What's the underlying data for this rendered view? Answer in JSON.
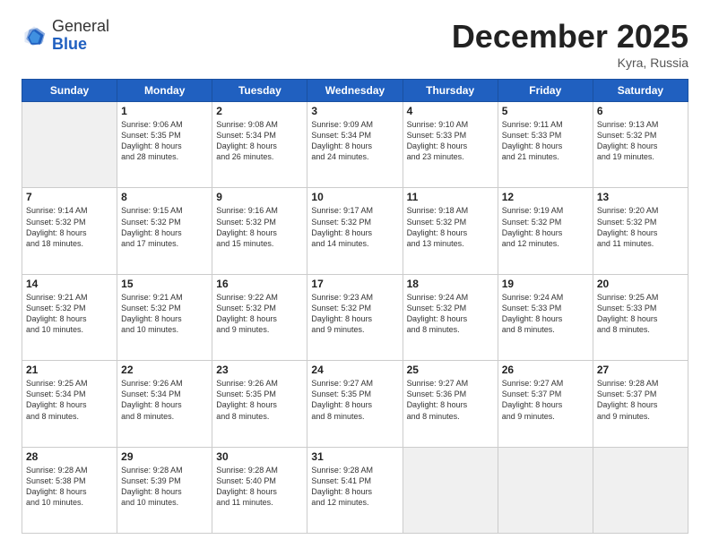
{
  "logo": {
    "general": "General",
    "blue": "Blue"
  },
  "header": {
    "month": "December 2025",
    "location": "Kyra, Russia"
  },
  "days_of_week": [
    "Sunday",
    "Monday",
    "Tuesday",
    "Wednesday",
    "Thursday",
    "Friday",
    "Saturday"
  ],
  "weeks": [
    [
      {
        "day": "",
        "info": "",
        "empty": true
      },
      {
        "day": "1",
        "info": "Sunrise: 9:06 AM\nSunset: 5:35 PM\nDaylight: 8 hours\nand 28 minutes."
      },
      {
        "day": "2",
        "info": "Sunrise: 9:08 AM\nSunset: 5:34 PM\nDaylight: 8 hours\nand 26 minutes."
      },
      {
        "day": "3",
        "info": "Sunrise: 9:09 AM\nSunset: 5:34 PM\nDaylight: 8 hours\nand 24 minutes."
      },
      {
        "day": "4",
        "info": "Sunrise: 9:10 AM\nSunset: 5:33 PM\nDaylight: 8 hours\nand 23 minutes."
      },
      {
        "day": "5",
        "info": "Sunrise: 9:11 AM\nSunset: 5:33 PM\nDaylight: 8 hours\nand 21 minutes."
      },
      {
        "day": "6",
        "info": "Sunrise: 9:13 AM\nSunset: 5:32 PM\nDaylight: 8 hours\nand 19 minutes."
      }
    ],
    [
      {
        "day": "7",
        "info": "Sunrise: 9:14 AM\nSunset: 5:32 PM\nDaylight: 8 hours\nand 18 minutes."
      },
      {
        "day": "8",
        "info": "Sunrise: 9:15 AM\nSunset: 5:32 PM\nDaylight: 8 hours\nand 17 minutes."
      },
      {
        "day": "9",
        "info": "Sunrise: 9:16 AM\nSunset: 5:32 PM\nDaylight: 8 hours\nand 15 minutes."
      },
      {
        "day": "10",
        "info": "Sunrise: 9:17 AM\nSunset: 5:32 PM\nDaylight: 8 hours\nand 14 minutes."
      },
      {
        "day": "11",
        "info": "Sunrise: 9:18 AM\nSunset: 5:32 PM\nDaylight: 8 hours\nand 13 minutes."
      },
      {
        "day": "12",
        "info": "Sunrise: 9:19 AM\nSunset: 5:32 PM\nDaylight: 8 hours\nand 12 minutes."
      },
      {
        "day": "13",
        "info": "Sunrise: 9:20 AM\nSunset: 5:32 PM\nDaylight: 8 hours\nand 11 minutes."
      }
    ],
    [
      {
        "day": "14",
        "info": "Sunrise: 9:21 AM\nSunset: 5:32 PM\nDaylight: 8 hours\nand 10 minutes."
      },
      {
        "day": "15",
        "info": "Sunrise: 9:21 AM\nSunset: 5:32 PM\nDaylight: 8 hours\nand 10 minutes."
      },
      {
        "day": "16",
        "info": "Sunrise: 9:22 AM\nSunset: 5:32 PM\nDaylight: 8 hours\nand 9 minutes."
      },
      {
        "day": "17",
        "info": "Sunrise: 9:23 AM\nSunset: 5:32 PM\nDaylight: 8 hours\nand 9 minutes."
      },
      {
        "day": "18",
        "info": "Sunrise: 9:24 AM\nSunset: 5:32 PM\nDaylight: 8 hours\nand 8 minutes."
      },
      {
        "day": "19",
        "info": "Sunrise: 9:24 AM\nSunset: 5:33 PM\nDaylight: 8 hours\nand 8 minutes."
      },
      {
        "day": "20",
        "info": "Sunrise: 9:25 AM\nSunset: 5:33 PM\nDaylight: 8 hours\nand 8 minutes."
      }
    ],
    [
      {
        "day": "21",
        "info": "Sunrise: 9:25 AM\nSunset: 5:34 PM\nDaylight: 8 hours\nand 8 minutes."
      },
      {
        "day": "22",
        "info": "Sunrise: 9:26 AM\nSunset: 5:34 PM\nDaylight: 8 hours\nand 8 minutes."
      },
      {
        "day": "23",
        "info": "Sunrise: 9:26 AM\nSunset: 5:35 PM\nDaylight: 8 hours\nand 8 minutes."
      },
      {
        "day": "24",
        "info": "Sunrise: 9:27 AM\nSunset: 5:35 PM\nDaylight: 8 hours\nand 8 minutes."
      },
      {
        "day": "25",
        "info": "Sunrise: 9:27 AM\nSunset: 5:36 PM\nDaylight: 8 hours\nand 8 minutes."
      },
      {
        "day": "26",
        "info": "Sunrise: 9:27 AM\nSunset: 5:37 PM\nDaylight: 8 hours\nand 9 minutes."
      },
      {
        "day": "27",
        "info": "Sunrise: 9:28 AM\nSunset: 5:37 PM\nDaylight: 8 hours\nand 9 minutes."
      }
    ],
    [
      {
        "day": "28",
        "info": "Sunrise: 9:28 AM\nSunset: 5:38 PM\nDaylight: 8 hours\nand 10 minutes."
      },
      {
        "day": "29",
        "info": "Sunrise: 9:28 AM\nSunset: 5:39 PM\nDaylight: 8 hours\nand 10 minutes."
      },
      {
        "day": "30",
        "info": "Sunrise: 9:28 AM\nSunset: 5:40 PM\nDaylight: 8 hours\nand 11 minutes."
      },
      {
        "day": "31",
        "info": "Sunrise: 9:28 AM\nSunset: 5:41 PM\nDaylight: 8 hours\nand 12 minutes."
      },
      {
        "day": "",
        "info": "",
        "empty": true
      },
      {
        "day": "",
        "info": "",
        "empty": true
      },
      {
        "day": "",
        "info": "",
        "empty": true
      }
    ]
  ]
}
